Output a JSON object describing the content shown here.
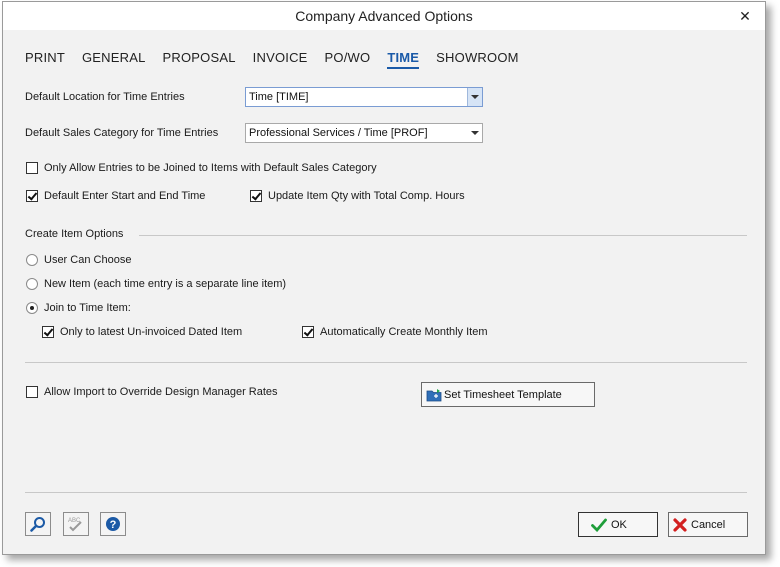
{
  "window": {
    "title": "Company Advanced Options"
  },
  "tabs": [
    {
      "label": "PRINT"
    },
    {
      "label": "GENERAL"
    },
    {
      "label": "PROPOSAL"
    },
    {
      "label": "INVOICE"
    },
    {
      "label": "PO/WO"
    },
    {
      "label": "TIME",
      "active": true
    },
    {
      "label": "SHOWROOM"
    }
  ],
  "fields": {
    "default_location_label": "Default Location for Time Entries",
    "default_location_value": "Time [TIME]",
    "default_sales_label": "Default Sales Category for Time Entries",
    "default_sales_value": "Professional Services / Time [PROF]"
  },
  "checkboxes": {
    "only_allow": {
      "label": "Only Allow Entries to be Joined to Items with Default Sales Category",
      "checked": false
    },
    "default_enter": {
      "label": "Default Enter Start and End Time",
      "checked": true
    },
    "update_qty": {
      "label": "Update Item Qty with Total Comp. Hours",
      "checked": true
    },
    "only_latest": {
      "label": "Only to latest Un-invoiced Dated Item",
      "checked": true
    },
    "auto_monthly": {
      "label": "Automatically Create Monthly Item",
      "checked": true
    },
    "allow_import": {
      "label": "Allow Import to Override Design Manager Rates",
      "checked": false
    }
  },
  "create_item": {
    "section_label": "Create Item Options",
    "options": [
      {
        "label": "User Can Choose",
        "selected": false
      },
      {
        "label": "New Item (each time entry is a separate line item)",
        "selected": false
      },
      {
        "label": "Join to Time Item:",
        "selected": true
      }
    ]
  },
  "buttons": {
    "timesheet_template": "Set Timesheet Template",
    "ok": "OK",
    "cancel": "Cancel"
  },
  "icons": {
    "search": "magnifier-icon",
    "spellcheck": "spellcheck-icon",
    "help": "help-icon",
    "folder": "folder-icon"
  },
  "colors": {
    "accent": "#1a5aa8",
    "ok_check": "#1f9e3a",
    "cancel_x": "#d32020"
  }
}
